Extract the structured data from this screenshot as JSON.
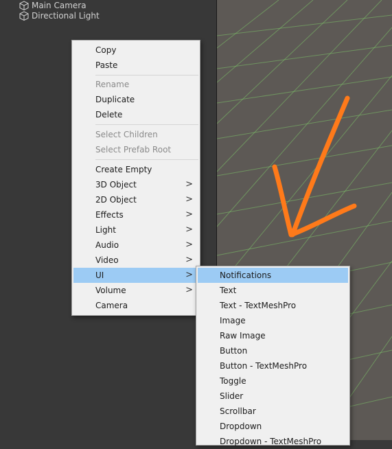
{
  "hierarchy": {
    "items": [
      {
        "label": "Main Camera",
        "icon": "gameobject-cube-icon"
      },
      {
        "label": "Directional Light",
        "icon": "gameobject-cube-icon"
      }
    ]
  },
  "scene": {
    "background_color": "#5d5955",
    "grid_color": "#7dc46a",
    "annotation_arrow_color": "#ff7a1a"
  },
  "context_menu": {
    "items": [
      {
        "label": "Copy",
        "enabled": true
      },
      {
        "label": "Paste",
        "enabled": true
      },
      {
        "label": "Rename",
        "enabled": false
      },
      {
        "label": "Duplicate",
        "enabled": true
      },
      {
        "label": "Delete",
        "enabled": true
      },
      {
        "label": "Select Children",
        "enabled": false
      },
      {
        "label": "Select Prefab Root",
        "enabled": false
      },
      {
        "label": "Create Empty",
        "enabled": true
      },
      {
        "label": "3D Object",
        "enabled": true,
        "submenu": true
      },
      {
        "label": "2D Object",
        "enabled": true,
        "submenu": true
      },
      {
        "label": "Effects",
        "enabled": true,
        "submenu": true
      },
      {
        "label": "Light",
        "enabled": true,
        "submenu": true
      },
      {
        "label": "Audio",
        "enabled": true,
        "submenu": true
      },
      {
        "label": "Video",
        "enabled": true,
        "submenu": true
      },
      {
        "label": "UI",
        "enabled": true,
        "submenu": true,
        "highlighted": true
      },
      {
        "label": "Volume",
        "enabled": true,
        "submenu": true
      },
      {
        "label": "Camera",
        "enabled": true
      }
    ],
    "submenu_arrow": ">"
  },
  "ui_submenu": {
    "items": [
      {
        "label": "Notifications",
        "highlighted": true
      },
      {
        "label": "Text"
      },
      {
        "label": "Text - TextMeshPro"
      },
      {
        "label": "Image"
      },
      {
        "label": "Raw Image"
      },
      {
        "label": "Button"
      },
      {
        "label": "Button - TextMeshPro"
      },
      {
        "label": "Toggle"
      },
      {
        "label": "Slider"
      },
      {
        "label": "Scrollbar"
      },
      {
        "label": "Dropdown"
      },
      {
        "label": "Dropdown - TextMeshPro"
      }
    ]
  },
  "colors": {
    "menu_bg": "#f0f0f0",
    "menu_highlight": "#9ccbf4",
    "disabled_text": "#8a8a8a"
  }
}
